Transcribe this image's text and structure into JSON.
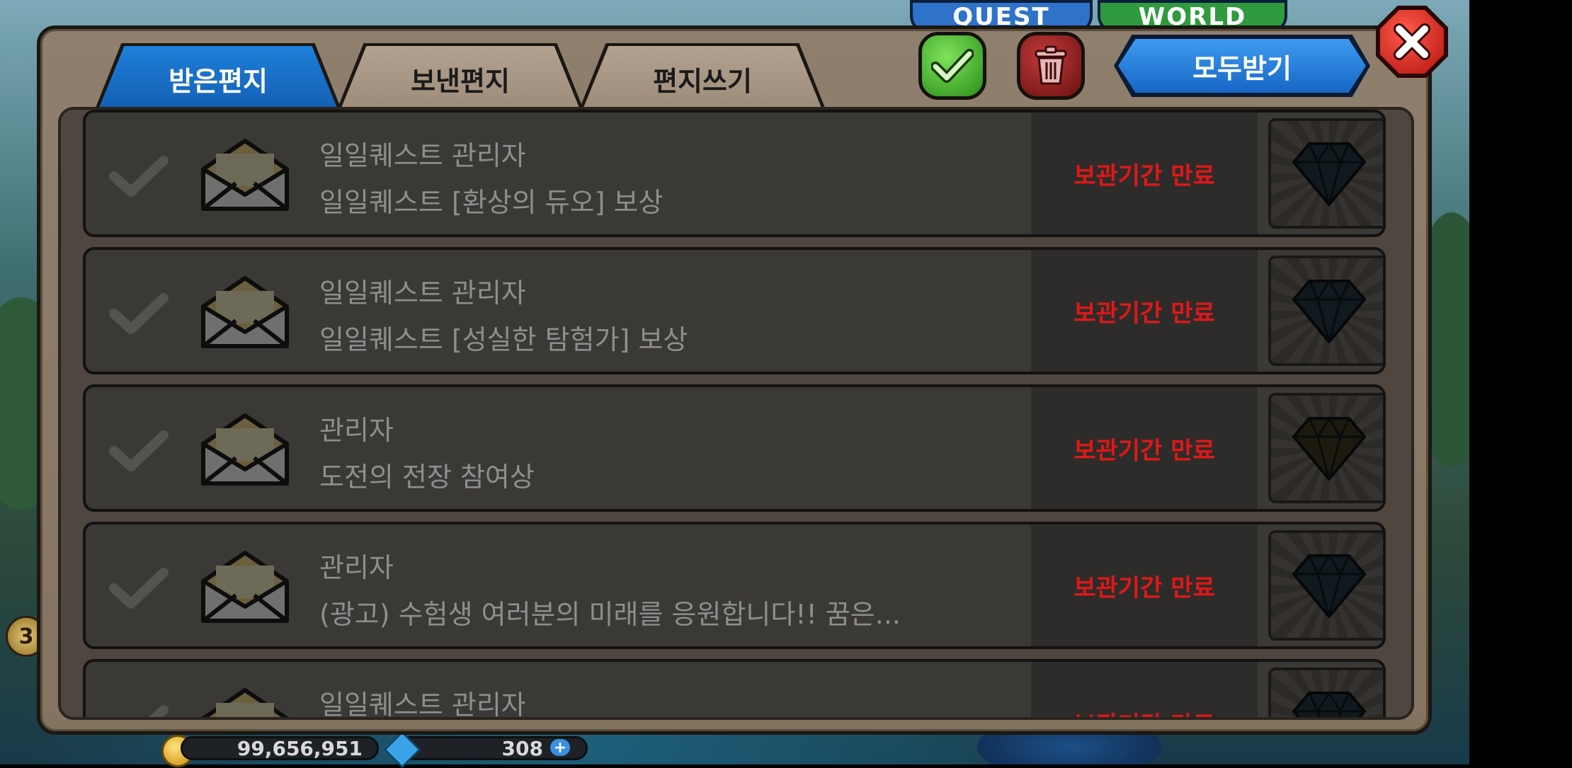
{
  "background": {
    "quest_label": "QUEST",
    "world_label": "WORLD",
    "level": "3",
    "gold": "99,656,951",
    "gems": "308"
  },
  "tabs": {
    "inbox": "받은편지",
    "sent": "보낸편지",
    "write": "편지쓰기"
  },
  "toolbar": {
    "receive_all": "모두받기"
  },
  "colors": {
    "tab_active": "#1f7fd8",
    "status_expired": "#e01818",
    "select_button": "#2a8e1a",
    "delete_button": "#6a1111"
  },
  "mails": [
    {
      "sender": "일일퀘스트 관리자",
      "subject": "일일퀘스트 [환상의 듀오] 보상",
      "status": "보관기간 만료",
      "reward_icon": "gem-icon"
    },
    {
      "sender": "일일퀘스트 관리자",
      "subject": "일일퀘스트 [성실한 탐험가] 보상",
      "status": "보관기간 만료",
      "reward_icon": "gem-icon"
    },
    {
      "sender": "관리자",
      "subject": "도전의 전장 참여상",
      "status": "보관기간 만료",
      "reward_icon": "gem-icon"
    },
    {
      "sender": "관리자",
      "subject": "(광고) 수험생 여러분의 미래를 응원합니다!! 꿈은...",
      "status": "보관기간 만료",
      "reward_icon": "gem-icon"
    },
    {
      "sender": "일일퀘스트 관리자",
      "subject": "",
      "status": "보관기간 만료",
      "reward_icon": "gem-icon"
    }
  ]
}
